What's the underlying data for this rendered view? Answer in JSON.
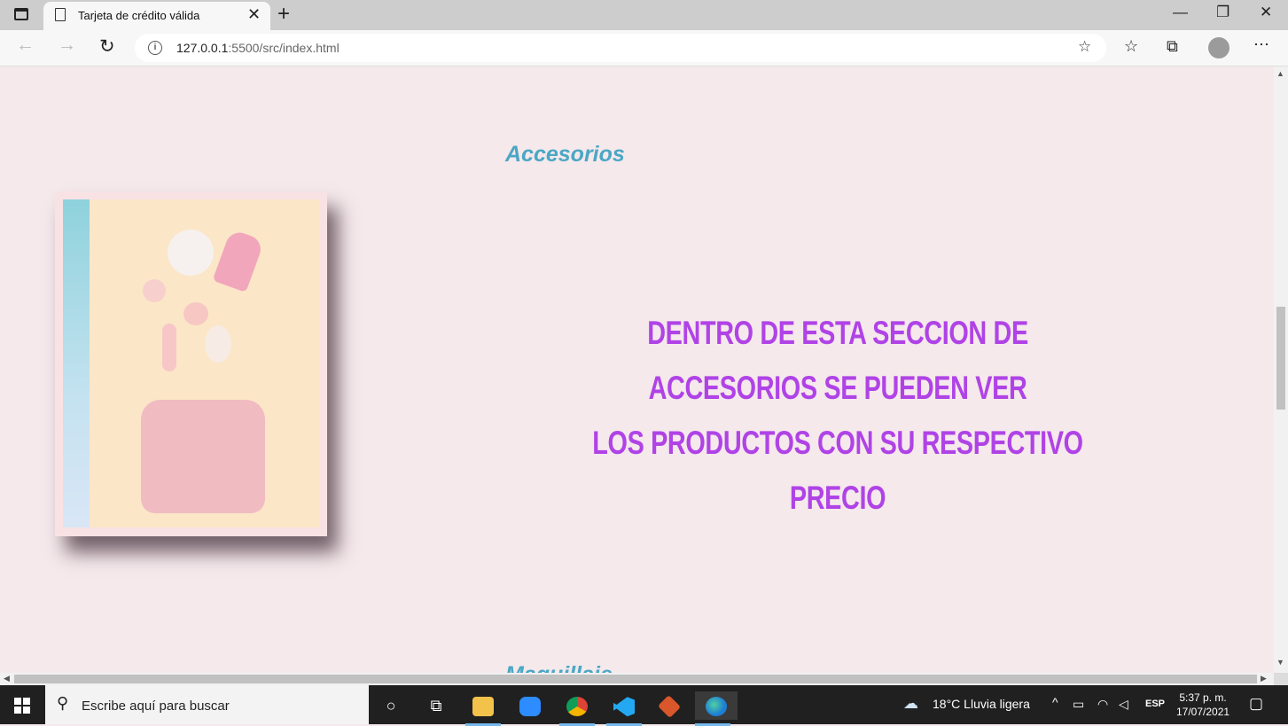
{
  "browser": {
    "tab_title": "Tarjeta de crédito válida",
    "url_host": "127.0.0.1",
    "url_rest": ":5500/src/index.html"
  },
  "page": {
    "section_title": "Accesorios",
    "description_line1": "DENTRO DE ESTA SECCION DE ACCESORIOS SE PUEDEN  VER",
    "description_line2": "LOS PRODUCTOS CON SU RESPECTIVO PRECIO",
    "next_section_title": "Maquillaje"
  },
  "taskbar": {
    "search_placeholder": "Escribe aquí para buscar",
    "weather": "18°C  Lluvia ligera",
    "language": "ESP",
    "time": "5:37 p. m.",
    "date": "17/07/2021"
  },
  "colors": {
    "page_background": "#f5e9ec",
    "section_title": "#4ba7c4",
    "description": "#b043e6"
  }
}
